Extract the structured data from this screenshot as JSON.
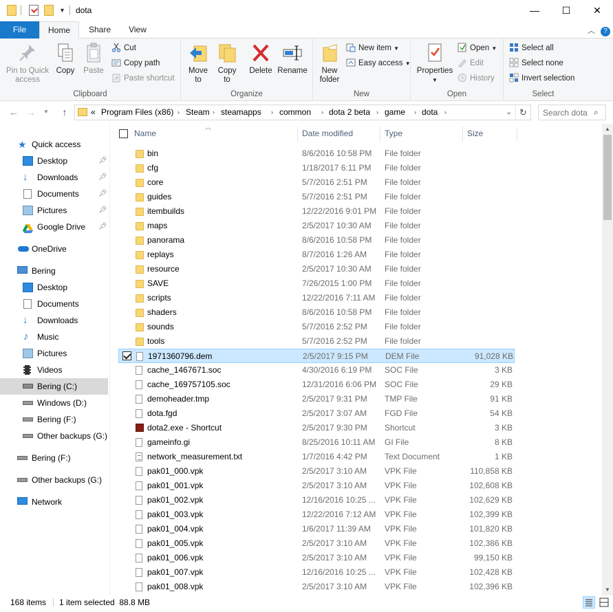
{
  "window": {
    "title": "dota",
    "controls": {
      "minimize": "—",
      "maximize": "☐",
      "close": "✕"
    }
  },
  "ribbon": {
    "tabs": [
      {
        "label": "File",
        "active": false
      },
      {
        "label": "Home",
        "active": true
      },
      {
        "label": "Share",
        "active": false
      },
      {
        "label": "View",
        "active": false
      }
    ],
    "clipboard": {
      "label": "Clipboard",
      "pin_quick_access": "Pin to Quick access",
      "pin_line1": "Pin to Quick",
      "pin_line2": "access",
      "copy": "Copy",
      "paste": "Paste",
      "cut": "Cut",
      "copy_path": "Copy path",
      "paste_shortcut": "Paste shortcut"
    },
    "organize": {
      "label": "Organize",
      "move_to_line1": "Move",
      "move_to_line2": "to",
      "copy_to_line1": "Copy",
      "copy_to_line2": "to",
      "delete": "Delete",
      "rename": "Rename"
    },
    "new": {
      "label": "New",
      "new_folder_line1": "New",
      "new_folder_line2": "folder",
      "new_item": "New item",
      "easy_access": "Easy access"
    },
    "open": {
      "label": "Open",
      "properties": "Properties",
      "open": "Open",
      "edit": "Edit",
      "history": "History"
    },
    "select": {
      "label": "Select",
      "select_all": "Select all",
      "select_none": "Select none",
      "invert_selection": "Invert selection"
    }
  },
  "address": {
    "overflow": "«",
    "crumbs": [
      "Program Files (x86)",
      "Steam",
      "steamapps",
      "common",
      "dota 2 beta",
      "game",
      "dota"
    ],
    "search_placeholder": "Search dota"
  },
  "nav": {
    "quick_access": "Quick access",
    "quick_items": [
      "Desktop",
      "Downloads",
      "Documents",
      "Pictures",
      "Google Drive"
    ],
    "onedrive": "OneDrive",
    "pc": "Bering",
    "pc_items": [
      "Desktop",
      "Documents",
      "Downloads",
      "Music",
      "Pictures",
      "Videos",
      "Bering (C:)",
      "Windows (D:)",
      "Bering (F:)",
      "Other backups (G:)"
    ],
    "drive_f": "Bering (F:)",
    "drive_g": "Other backups (G:)",
    "network": "Network"
  },
  "columns": {
    "name": "Name",
    "date": "Date modified",
    "type": "Type",
    "size": "Size"
  },
  "files": [
    {
      "name": "bin",
      "date": "8/6/2016 10:58 PM",
      "type": "File folder",
      "size": "",
      "icon": "folder"
    },
    {
      "name": "cfg",
      "date": "1/18/2017 6:11 PM",
      "type": "File folder",
      "size": "",
      "icon": "folder"
    },
    {
      "name": "core",
      "date": "5/7/2016 2:51 PM",
      "type": "File folder",
      "size": "",
      "icon": "folder"
    },
    {
      "name": "guides",
      "date": "5/7/2016 2:51 PM",
      "type": "File folder",
      "size": "",
      "icon": "folder"
    },
    {
      "name": "itembuilds",
      "date": "12/22/2016 9:01 PM",
      "type": "File folder",
      "size": "",
      "icon": "folder"
    },
    {
      "name": "maps",
      "date": "2/5/2017 10:30 AM",
      "type": "File folder",
      "size": "",
      "icon": "folder"
    },
    {
      "name": "panorama",
      "date": "8/6/2016 10:58 PM",
      "type": "File folder",
      "size": "",
      "icon": "folder"
    },
    {
      "name": "replays",
      "date": "8/7/2016 1:26 AM",
      "type": "File folder",
      "size": "",
      "icon": "folder"
    },
    {
      "name": "resource",
      "date": "2/5/2017 10:30 AM",
      "type": "File folder",
      "size": "",
      "icon": "folder"
    },
    {
      "name": "SAVE",
      "date": "7/26/2015 1:00 PM",
      "type": "File folder",
      "size": "",
      "icon": "folder"
    },
    {
      "name": "scripts",
      "date": "12/22/2016 7:11 AM",
      "type": "File folder",
      "size": "",
      "icon": "folder"
    },
    {
      "name": "shaders",
      "date": "8/6/2016 10:58 PM",
      "type": "File folder",
      "size": "",
      "icon": "folder"
    },
    {
      "name": "sounds",
      "date": "5/7/2016 2:52 PM",
      "type": "File folder",
      "size": "",
      "icon": "folder"
    },
    {
      "name": "tools",
      "date": "5/7/2016 2:52 PM",
      "type": "File folder",
      "size": "",
      "icon": "folder"
    },
    {
      "name": "1971360796.dem",
      "date": "2/5/2017 9:15 PM",
      "type": "DEM File",
      "size": "91,028 KB",
      "icon": "file",
      "selected": true
    },
    {
      "name": "cache_1467671.soc",
      "date": "4/30/2016 6:19 PM",
      "type": "SOC File",
      "size": "3 KB",
      "icon": "file"
    },
    {
      "name": "cache_169757105.soc",
      "date": "12/31/2016 6:06 PM",
      "type": "SOC File",
      "size": "29 KB",
      "icon": "file"
    },
    {
      "name": "demoheader.tmp",
      "date": "2/5/2017 9:31 PM",
      "type": "TMP File",
      "size": "91 KB",
      "icon": "file"
    },
    {
      "name": "dota.fgd",
      "date": "2/5/2017 3:07 AM",
      "type": "FGD File",
      "size": "54 KB",
      "icon": "file"
    },
    {
      "name": "dota2.exe - Shortcut",
      "date": "2/5/2017 9:30 PM",
      "type": "Shortcut",
      "size": "3 KB",
      "icon": "shortcut"
    },
    {
      "name": "gameinfo.gi",
      "date": "8/25/2016 10:11 AM",
      "type": "GI File",
      "size": "8 KB",
      "icon": "file"
    },
    {
      "name": "network_measurement.txt",
      "date": "1/7/2016 4:42 PM",
      "type": "Text Document",
      "size": "1 KB",
      "icon": "text"
    },
    {
      "name": "pak01_000.vpk",
      "date": "2/5/2017 3:10 AM",
      "type": "VPK File",
      "size": "110,858 KB",
      "icon": "file"
    },
    {
      "name": "pak01_001.vpk",
      "date": "2/5/2017 3:10 AM",
      "type": "VPK File",
      "size": "102,608 KB",
      "icon": "file"
    },
    {
      "name": "pak01_002.vpk",
      "date": "12/16/2016 10:25 ...",
      "type": "VPK File",
      "size": "102,629 KB",
      "icon": "file"
    },
    {
      "name": "pak01_003.vpk",
      "date": "12/22/2016 7:12 AM",
      "type": "VPK File",
      "size": "102,399 KB",
      "icon": "file"
    },
    {
      "name": "pak01_004.vpk",
      "date": "1/6/2017 11:39 AM",
      "type": "VPK File",
      "size": "101,820 KB",
      "icon": "file"
    },
    {
      "name": "pak01_005.vpk",
      "date": "2/5/2017 3:10 AM",
      "type": "VPK File",
      "size": "102,386 KB",
      "icon": "file"
    },
    {
      "name": "pak01_006.vpk",
      "date": "2/5/2017 3:10 AM",
      "type": "VPK File",
      "size": "99,150 KB",
      "icon": "file"
    },
    {
      "name": "pak01_007.vpk",
      "date": "12/16/2016 10:25 ...",
      "type": "VPK File",
      "size": "102,428 KB",
      "icon": "file"
    },
    {
      "name": "pak01_008.vpk",
      "date": "2/5/2017 3:10 AM",
      "type": "VPK File",
      "size": "102,396 KB",
      "icon": "file"
    }
  ],
  "status": {
    "item_count": "168 items",
    "selection": "1 item selected  88.8 MB"
  },
  "colors": {
    "accent": "#1979ca",
    "selection_bg": "#cce8ff",
    "selection_border": "#99d1ff",
    "folder": "#f8d775"
  }
}
